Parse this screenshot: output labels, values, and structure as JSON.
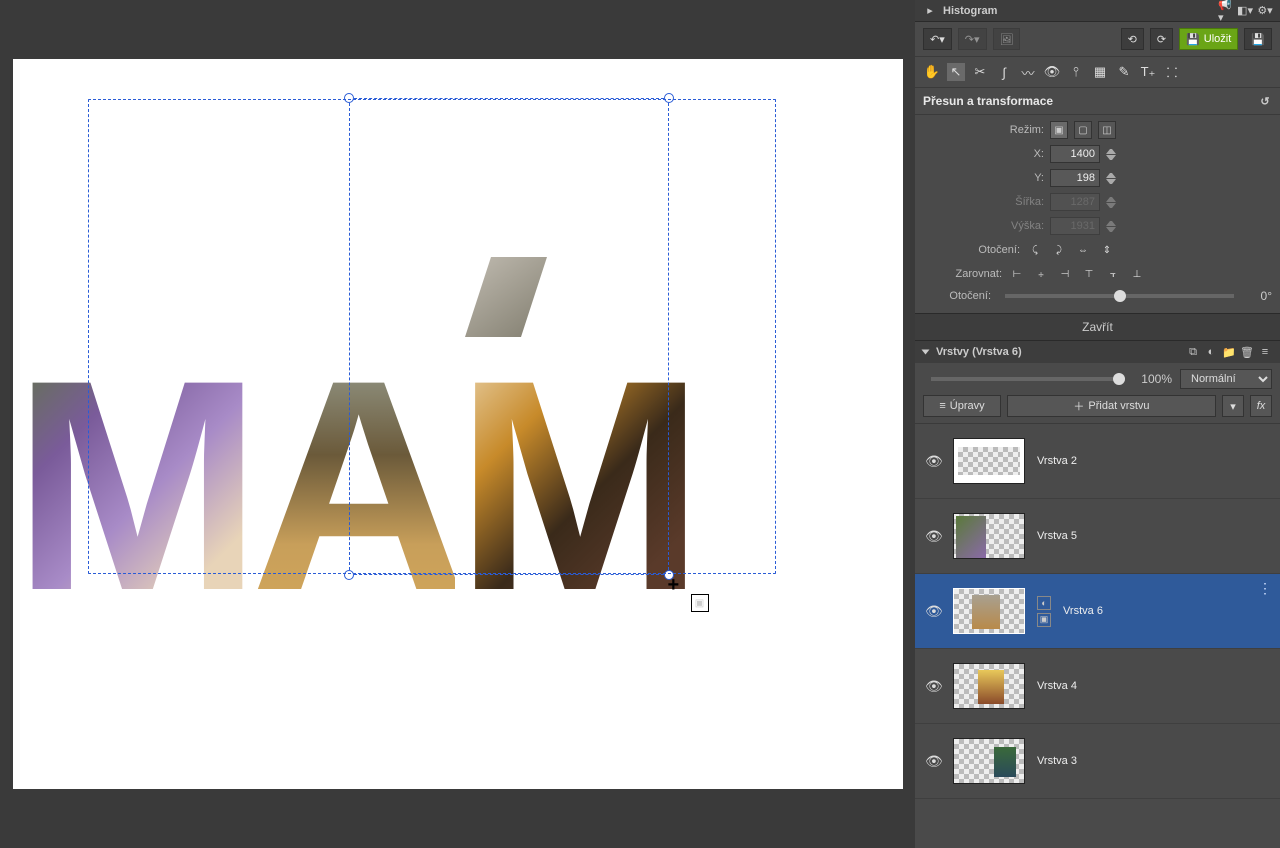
{
  "histogram_label": "Histogram",
  "save_label": "Uložit",
  "transform_title": "Přesun a transformace",
  "mode_label": "Režim:",
  "x_label": "X:",
  "x_value": "1400",
  "y_label": "Y:",
  "y_value": "198",
  "width_label": "Šířka:",
  "width_value": "1287",
  "height_label": "Výška:",
  "height_value": "1931",
  "rotate_label": "Otočení:",
  "align_label": "Zarovnat:",
  "rotate2_label": "Otočení:",
  "rotate_deg": "0°",
  "close_label": "Zavřít",
  "layers_title": "Vrstvy (Vrstva 6)",
  "opacity_value": "100%",
  "blend_mode": "Normální",
  "edits_label": "Úpravy",
  "add_layer_label": "Přidat vrstvu",
  "fx_label": "fx",
  "layers": {
    "l0": "Vrstva 2",
    "l1": "Vrstva 5",
    "l2": "Vrstva 6",
    "l3": "Vrstva 4",
    "l4": "Vrstva 3"
  },
  "canvas_text": "MÁM"
}
